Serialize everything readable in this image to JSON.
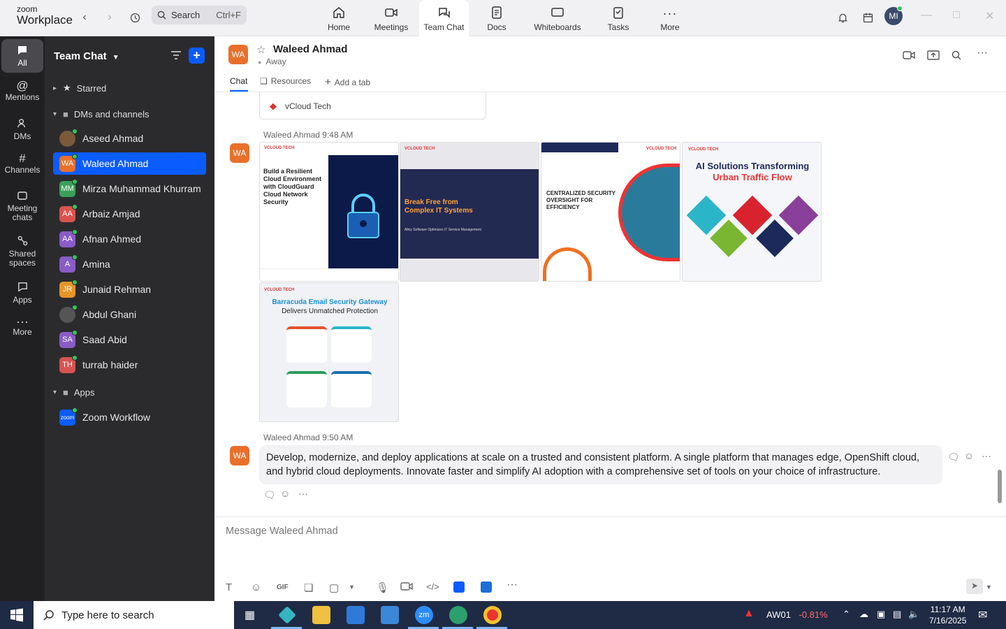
{
  "app": {
    "brand_small": "zoom",
    "brand_big": "Workplace"
  },
  "search": {
    "label": "Search",
    "shortcut": "Ctrl+F"
  },
  "nav": {
    "tabs": [
      {
        "label": "Home"
      },
      {
        "label": "Meetings"
      },
      {
        "label": "Team Chat"
      },
      {
        "label": "Docs"
      },
      {
        "label": "Whiteboards"
      },
      {
        "label": "Tasks"
      },
      {
        "label": "More"
      }
    ]
  },
  "me": {
    "initials": "MI"
  },
  "rail": {
    "items": [
      {
        "label": "All"
      },
      {
        "label": "Mentions"
      },
      {
        "label": "DMs"
      },
      {
        "label": "Channels"
      },
      {
        "label": "Meeting chats"
      },
      {
        "label": "Shared spaces"
      },
      {
        "label": "Apps"
      },
      {
        "label": "More"
      }
    ]
  },
  "sidebar": {
    "title": "Team Chat",
    "starred": "Starred",
    "dms_group": "DMs and channels",
    "apps_group": "Apps",
    "contacts": [
      {
        "name": "Aseed Ahmad",
        "initials": "",
        "color": "#7a5a3a"
      },
      {
        "name": "Waleed Ahmad",
        "initials": "WA",
        "color": "#e8702a"
      },
      {
        "name": "Mirza Muhammad Khurram",
        "initials": "MM",
        "color": "#3aa05a"
      },
      {
        "name": "Arbaiz Amjad",
        "initials": "AA",
        "color": "#d9534f"
      },
      {
        "name": "Afnan Ahmed",
        "initials": "AA",
        "color": "#8a5cc7"
      },
      {
        "name": "Amina",
        "initials": "A",
        "color": "#8a5cc7"
      },
      {
        "name": "Junaid Rehman",
        "initials": "JR",
        "color": "#e8952a"
      },
      {
        "name": "Abdul Ghani",
        "initials": "",
        "color": "#555"
      },
      {
        "name": "Saad Abid",
        "initials": "SA",
        "color": "#8a5cc7"
      },
      {
        "name": "turrab haider",
        "initials": "TH",
        "color": "#d9534f"
      }
    ],
    "app_item": {
      "name": "Zoom Workflow",
      "initials": "zoom",
      "color": "#0b5cff"
    }
  },
  "chat": {
    "header": {
      "name": "Waleed Ahmad",
      "initials": "WA",
      "status": "Away"
    },
    "tabs": {
      "chat": "Chat",
      "resources": "Resources",
      "add": "Add a tab"
    },
    "prev_card": "vCloud Tech",
    "msg1": {
      "author": "Waleed Ahmad",
      "time": "9:48 AM"
    },
    "images": [
      {
        "brand": "VCLOUD TECH",
        "headline": "Build a Resilient Cloud Environment with CloudGuard Cloud Network Security"
      },
      {
        "brand": "VCLOUD TECH",
        "headline": "Break Free from Complex IT Systems",
        "sub": "Alloy Software Optimizes IT Service Management"
      },
      {
        "brand": "VCLOUD TECH",
        "headline": "CENTRALIZED SECURITY OVERSIGHT FOR EFFICIENCY"
      },
      {
        "brand": "VCLOUD TECH",
        "headline": "AI Solutions Transforming",
        "headline2": "Urban Traffic Flow"
      },
      {
        "brand": "VCLOUD TECH",
        "headline": "Barracuda Email Security Gateway",
        "headline2": "Delivers Unmatched Protection"
      }
    ],
    "msg2": {
      "author": "Waleed Ahmad",
      "time": "9:50 AM",
      "text": "Develop, modernize, and deploy applications at scale on a trusted and consistent platform. A single platform that manages edge, OpenShift cloud, and hybrid cloud deployments. Innovate faster and simplify AI adoption with a comprehensive set of tools on your choice of infrastructure."
    },
    "composer_placeholder": "Message Waleed Ahmad"
  },
  "taskbar": {
    "search": "Type here to search",
    "stock": "AW01",
    "stock_change": "-0.81%",
    "time": "11:17 AM",
    "date": "7/16/2025"
  }
}
